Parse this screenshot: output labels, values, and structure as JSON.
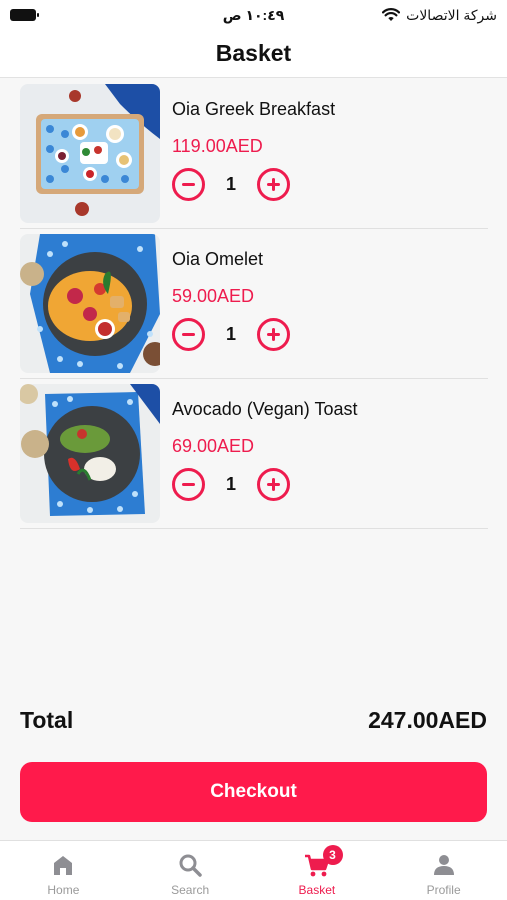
{
  "status_bar": {
    "time": "١٠:٤٩ ص",
    "carrier": "شركة الاتصالات"
  },
  "header": {
    "title": "Basket"
  },
  "items": [
    {
      "name": "Oia Greek Breakfast",
      "price": "119.00AED",
      "quantity": "1",
      "image": "greek-breakfast-photo"
    },
    {
      "name": "Oia Omelet",
      "price": "59.00AED",
      "quantity": "1",
      "image": "omelet-photo"
    },
    {
      "name": "Avocado (Vegan) Toast",
      "price": "69.00AED",
      "quantity": "1",
      "image": "avocado-toast-photo"
    }
  ],
  "summary": {
    "total_label": "Total",
    "total_value": "247.00AED"
  },
  "checkout": {
    "label": "Checkout"
  },
  "tabbar": {
    "home": "Home",
    "search": "Search",
    "basket": "Basket",
    "profile": "Profile",
    "basket_badge": "3",
    "active": "basket"
  },
  "colors": {
    "accent": "#ee1c4e",
    "checkout_bg": "#ff1a4b",
    "inactive": "#9a9a9a"
  }
}
